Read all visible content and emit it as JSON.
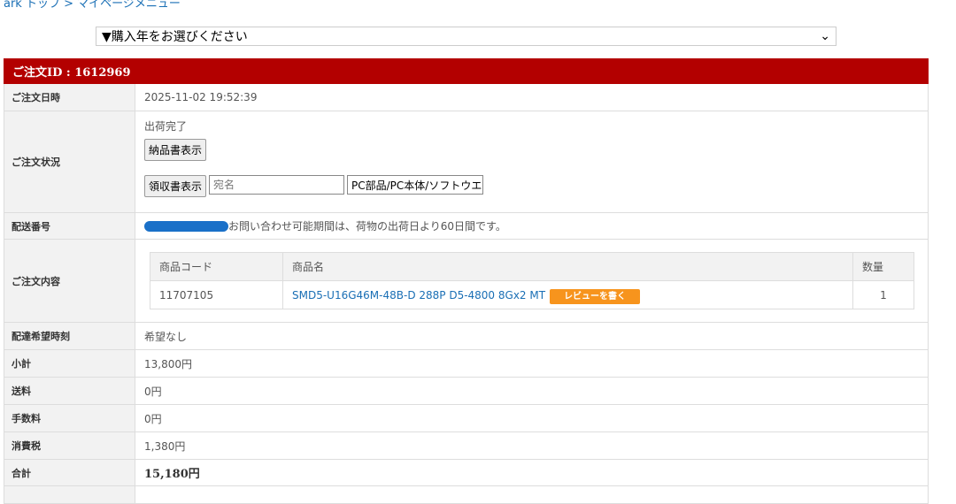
{
  "breadcrumb": "ark トップ > マイページメニュー",
  "year_select": "▼購入年をお選びください",
  "order": {
    "header": "ご注文ID : 1612969",
    "date_label": "ご注文日時",
    "date": "2025-11-02 19:52:39",
    "status_label": "ご注文状況",
    "status": "出荷完了",
    "delivery_note_button": "納品書表示",
    "receipt_button": "領収書表示",
    "addressee_placeholder": "宛名",
    "receipt_item": "PC部品/PC本体/ソフトウエ",
    "tracking_label": "配送番号",
    "tracking_note": "お問い合わせ可能期間は、荷物の出荷日より60日間です。",
    "contents_label": "ご注文内容",
    "items_headers": [
      "商品コード",
      "商品名",
      "数量"
    ],
    "items": [
      {
        "code": "11707105",
        "name": "SMD5-U16G46M-48B-D 288P D5-4800 8Gx2 MT",
        "review": "レビューを書く",
        "qty": "1"
      }
    ],
    "delivery_time_label": "配達希望時刻",
    "delivery_time": "希望なし",
    "subtotal_label": "小計",
    "subtotal": "13,800円",
    "shipping_label": "送料",
    "shipping": "0円",
    "fee_label": "手数料",
    "fee": "0円",
    "tax_label": "消費税",
    "tax": "1,380円",
    "total_label": "合計",
    "total": "15,180円"
  }
}
